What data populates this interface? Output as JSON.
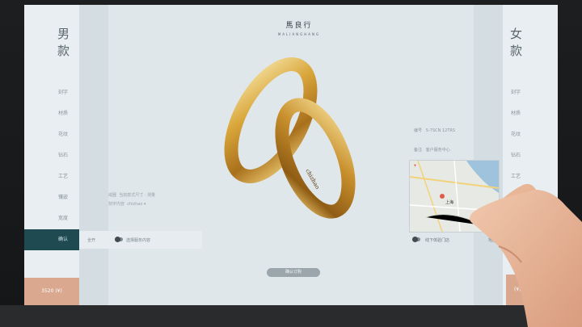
{
  "brand": {
    "name_cn": "馬良行",
    "name_en": "MALIANGHANG"
  },
  "left_panel": {
    "gender": "男款",
    "menu": [
      {
        "label": "刻字"
      },
      {
        "label": "材质"
      },
      {
        "label": "花纹"
      },
      {
        "label": "钻石"
      },
      {
        "label": "工艺"
      },
      {
        "label": "镶嵌"
      },
      {
        "label": "宽度"
      },
      {
        "label": "确认"
      }
    ],
    "active_index": 7,
    "price": "3520 (¥)",
    "options": [
      {
        "label": "戒圈",
        "value": "当前款式尺寸 · 测量"
      },
      {
        "label": "刻字内容",
        "value": "chizhao"
      }
    ],
    "toggle": {
      "label": "全开",
      "option": "选择服务内容"
    }
  },
  "center": {
    "cta_label": "确认订购"
  },
  "right_panel": {
    "gender": "女款",
    "menu": [
      {
        "label": "刻字"
      },
      {
        "label": "材质"
      },
      {
        "label": "花纹"
      },
      {
        "label": "钻石"
      },
      {
        "label": "工艺"
      }
    ],
    "price": "(¥)",
    "info": [
      {
        "label": "编号",
        "value": "S-7SCN 12TRS"
      },
      {
        "label": "备注",
        "value": "客户服务中心"
      }
    ],
    "map_city": "上海",
    "toggle": {
      "label": "线下体验门店",
      "option": "地图"
    }
  },
  "colors": {
    "accent": "#1f4a52",
    "price_bg": "#d9a88f",
    "gold": "#d9a63a"
  }
}
